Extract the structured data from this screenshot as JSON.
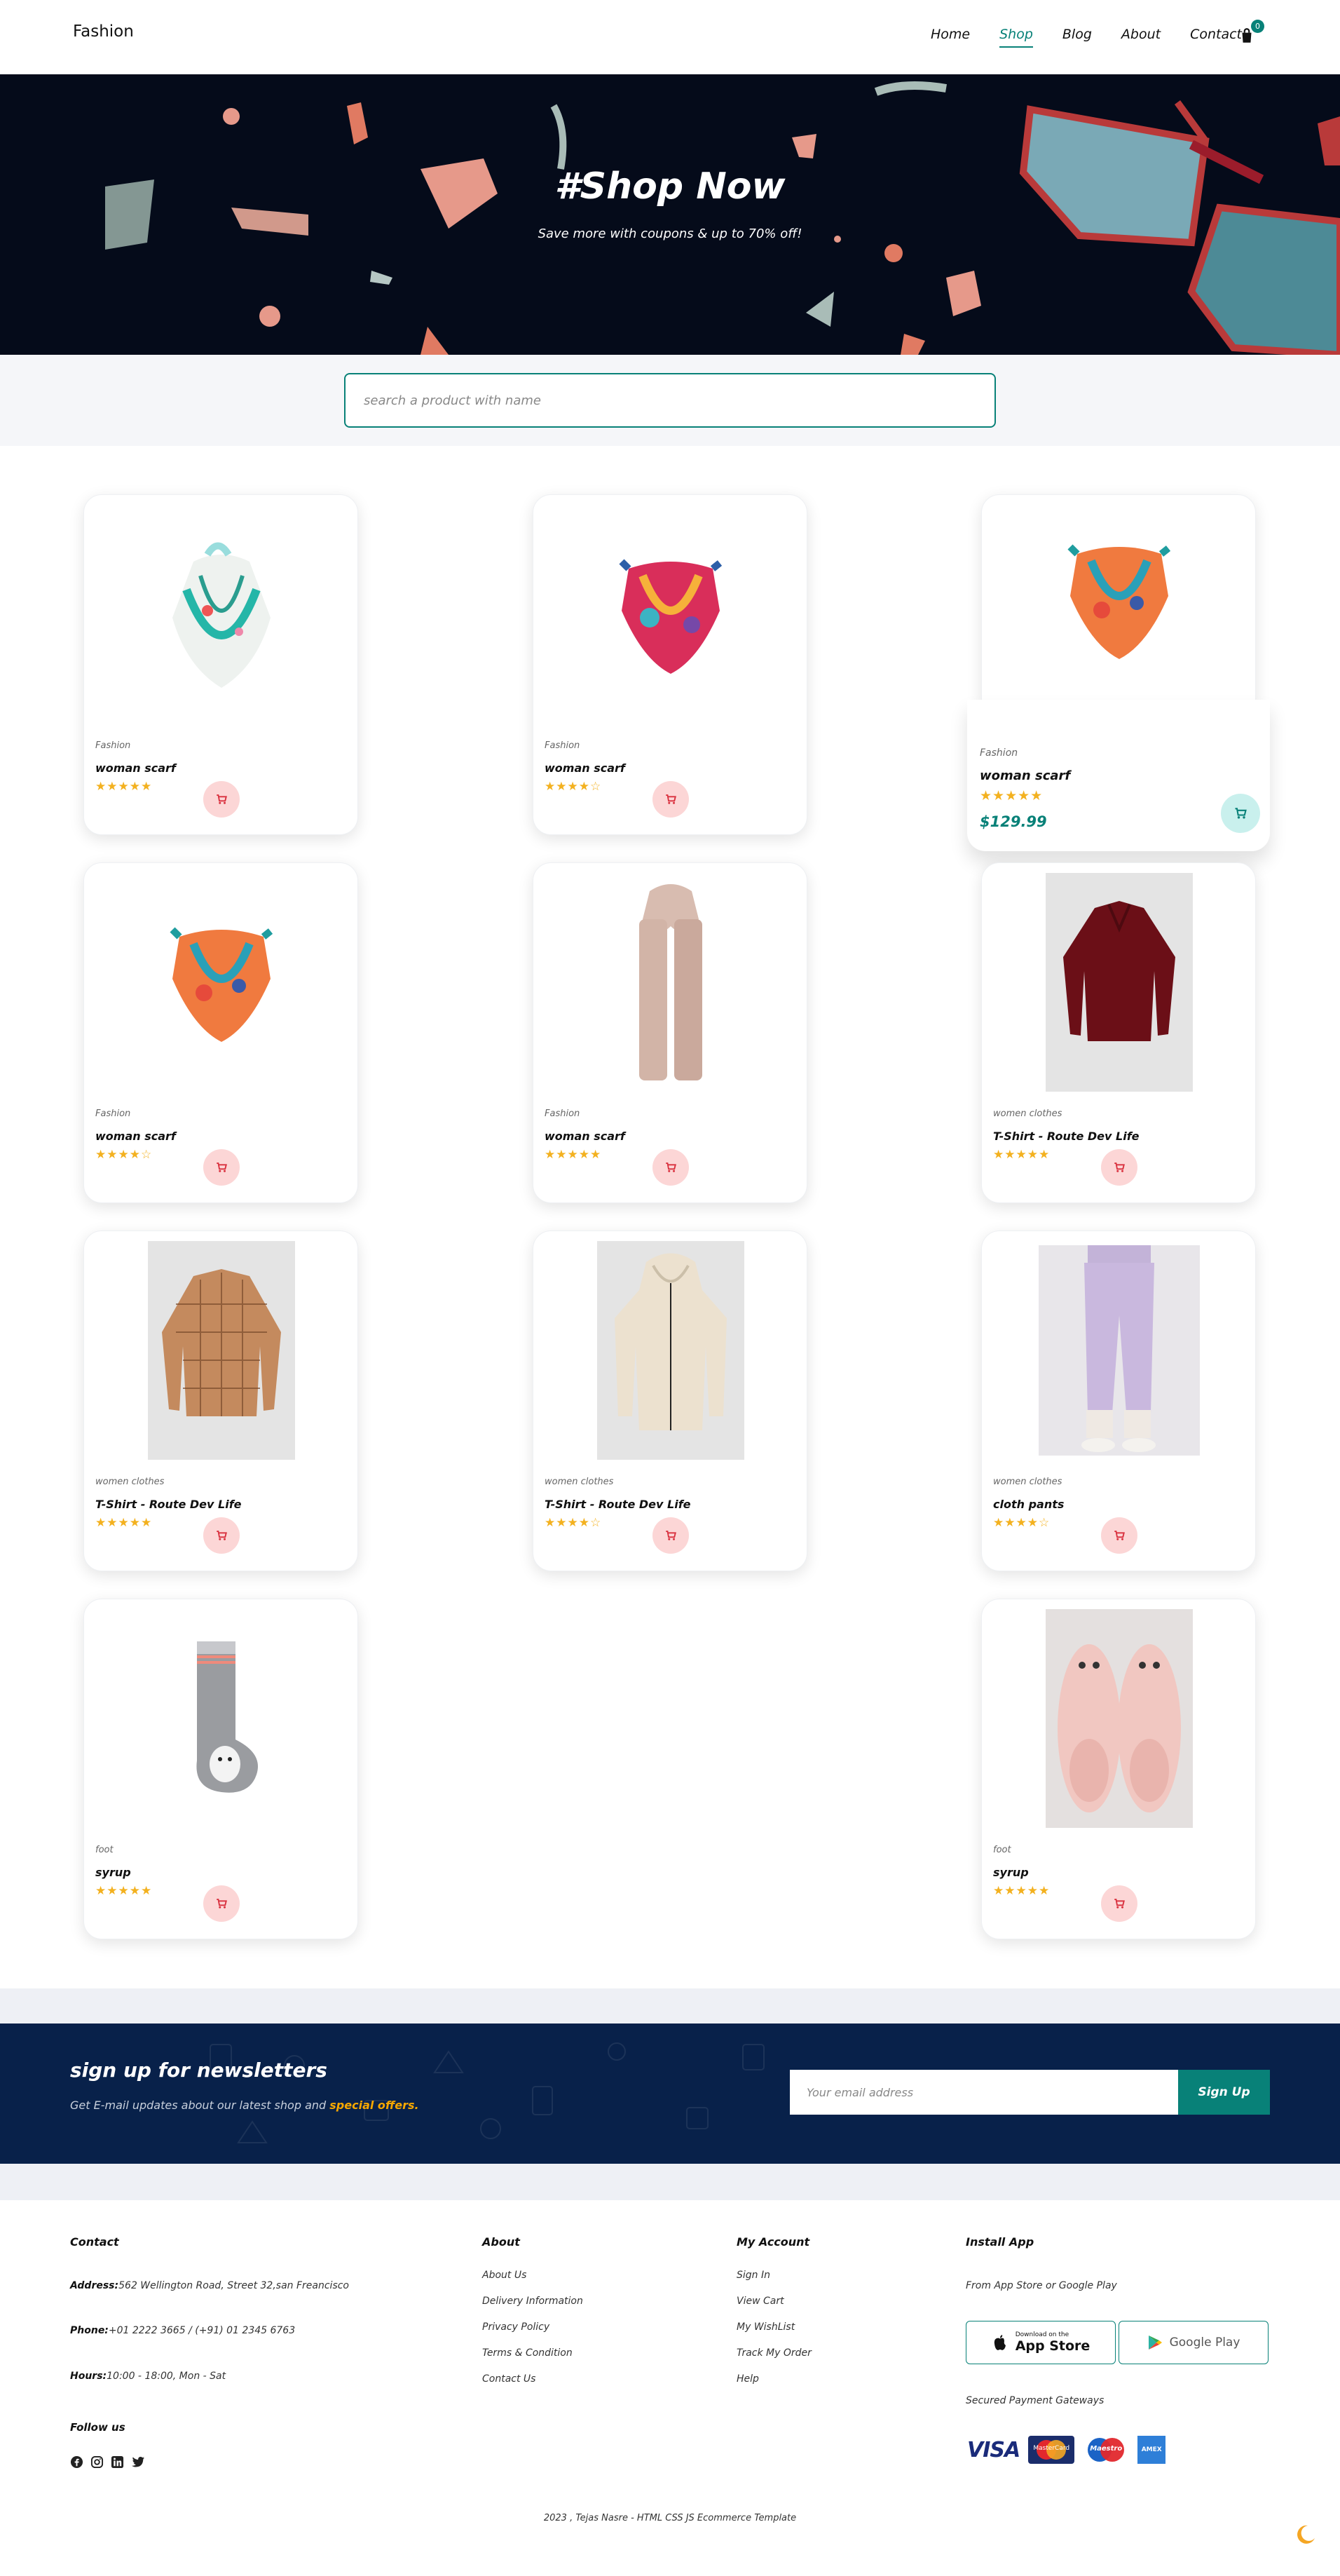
{
  "nav": {
    "logo": "Fashion",
    "links": [
      "Home",
      "Shop",
      "Blog",
      "About",
      "Contact"
    ],
    "active": "Shop",
    "cart_count": "0"
  },
  "hero": {
    "title": "#Shop Now",
    "subtitle": "Save more with coupons & up to 70% off!"
  },
  "search": {
    "placeholder": "search a product with name"
  },
  "products": [
    {
      "category": "Fashion",
      "name": "woman scarf",
      "stars": "★★★★★"
    },
    {
      "category": "Fashion",
      "name": "woman scarf",
      "stars": "★★★★☆"
    },
    {
      "category": "Fashion",
      "name": "woman scarf",
      "stars": "★★★★★",
      "price": "$129.99"
    },
    {
      "category": "Fashion",
      "name": "woman scarf",
      "stars": "★★★★☆"
    },
    {
      "category": "Fashion",
      "name": "woman scarf",
      "stars": "★★★★★"
    },
    {
      "category": "women clothes",
      "name": "T-Shirt - Route Dev Life",
      "stars": "★★★★★"
    },
    {
      "category": "women clothes",
      "name": "T-Shirt - Route Dev Life",
      "stars": "★★★★★"
    },
    {
      "category": "women clothes",
      "name": "T-Shirt - Route Dev Life",
      "stars": "★★★★☆"
    },
    {
      "category": "women clothes",
      "name": "cloth pants",
      "stars": "★★★★☆"
    },
    {
      "category": "foot",
      "name": "syrup",
      "stars": "★★★★★"
    },
    {
      "category": "foot",
      "name": "syrup",
      "stars": "★★★★★"
    }
  ],
  "newsletter": {
    "title": "sign up for newsletters",
    "text": "Get E-mail updates about our latest shop and",
    "highlight": "special offers.",
    "email_placeholder": "Your email address",
    "button": "Sign Up"
  },
  "footer": {
    "contact": {
      "title": "Contact",
      "address_label": "Address:",
      "address": "562 Wellington Road, Street 32,san Freancisco",
      "phone_label": "Phone:",
      "phone": "+01 2222 3665 / (+91) 01 2345 6763",
      "hours_label": "Hours:",
      "hours": "10:00 - 18:00, Mon - Sat",
      "follow": "Follow us"
    },
    "about": {
      "title": "About",
      "links": [
        "About Us",
        "Delivery Information",
        "Privacy Policy",
        "Terms & Condition",
        "Contact Us"
      ]
    },
    "account": {
      "title": "My Account",
      "links": [
        "Sign In",
        "View Cart",
        "My WishList",
        "Track My Order",
        "Help"
      ]
    },
    "app": {
      "title": "Install App",
      "text": "From App Store or Google Play",
      "appstore_small": "Download on the",
      "appstore": "App Store",
      "googleplay": "Google Play",
      "payments_title": "Secured Payment Gateways",
      "visa": "VISA",
      "mastercard": "MasterCard",
      "maestro": "Maestro",
      "amex": "AMEX"
    },
    "copyright": "2023 , Tejas Nasre - HTML CSS JS Ecommerce Template"
  }
}
